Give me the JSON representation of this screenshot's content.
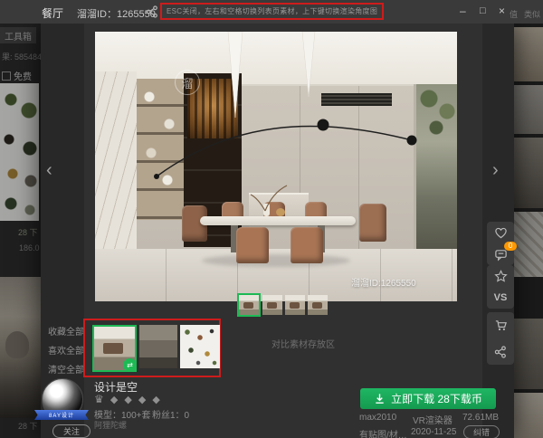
{
  "window": {
    "category": "餐厅",
    "material_id": "溜溜ID：1265550",
    "tooltip": "ESC关闭，左右和空格切换列表页素材，上下键切换渲染角度图",
    "bg_fragment_left": "值",
    "bg_fragment_right": "类似"
  },
  "icons": {
    "minimize": "–",
    "maximize": "□",
    "close": "×",
    "prev": "‹",
    "next": "›",
    "crown": "♛",
    "diamond": "◆",
    "compare_swap": "⇄"
  },
  "background_page": {
    "toolbox": "工具箱",
    "result_count": "果: 585484",
    "free_filter": "免费",
    "price_top": "28 下",
    "price_mid": "186.0",
    "price_bottom": "28 下"
  },
  "viewer": {
    "watermark": "溜溜ID:1265550",
    "watermark_logo": "溜"
  },
  "actions": {
    "comment_badge": "0",
    "vs_label": "VS"
  },
  "compare_panel": {
    "collect_all": "收藏全部",
    "like_all": "喜欢全部",
    "clear_all": "清空全部",
    "storage_label": "对比素材存放区"
  },
  "designer": {
    "name": "设计是空",
    "ribbon": "8AY设计",
    "follow": "关注",
    "models": "模型：100+套",
    "fans": "粉丝1：0",
    "alias": "阿狸陀螺"
  },
  "download": {
    "cta": "立即下载 28下载币",
    "format": "max2010",
    "renderer": "VR渲染器",
    "filesize": "72.61MB",
    "maps": "有贴图/材…",
    "date": "2020-11-25",
    "report": "纠错"
  },
  "colors": {
    "accent_green": "#17b35c",
    "selected_green": "#1db954",
    "annotation_red": "#ce1c1c",
    "badge_orange": "#ff9800"
  }
}
